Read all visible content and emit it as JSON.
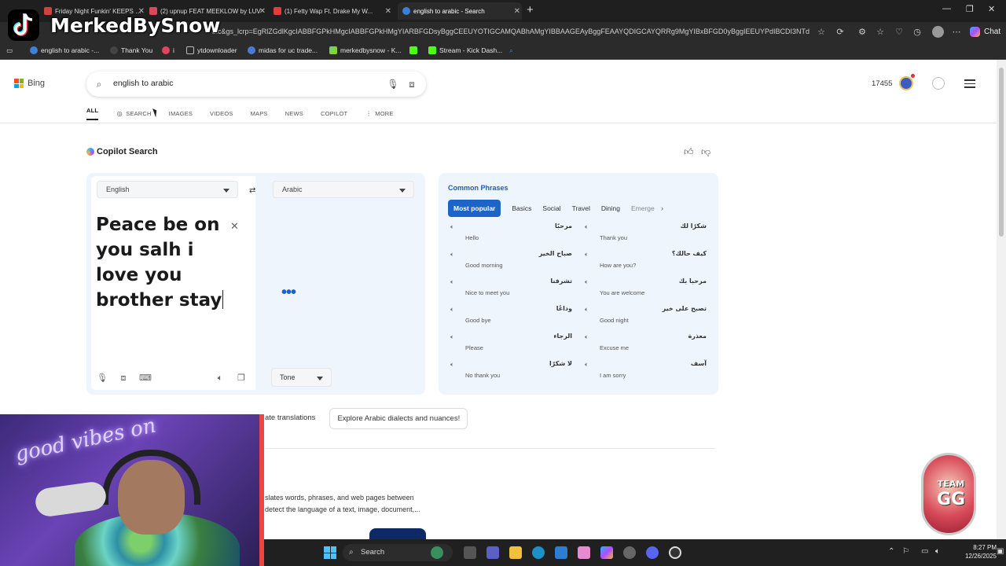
{
  "tabs": [
    {
      "label": "Friday Night Funkin' KEEPS GE...",
      "color": "#d43f3f"
    },
    {
      "label": "(2) upnup FEAT MEEKLOW by LUV",
      "color": "#e0465b"
    },
    {
      "label": "(1) Fetty Wap Ft. Drake My W...",
      "color": "#e43b3b"
    },
    {
      "label": "english to arabic - Search",
      "color": "#3b82d6"
    }
  ],
  "address": {
    "url": "bic&gs_lcrp=EgRlZGdlKgcIABBFGPkHMgcIABBFGPkHMgYIARBFGDsyBggCEEUYOTIGCAMQABhAMgYIBBAAGEAyBggFEAAYQDIGCAYQRRg9MgYIBxBFGD0yBggIEEUYPdIBCDI3NTdqMG..."
  },
  "chat_label": "Chat",
  "bookmarks": [
    {
      "label": "english to arabic -...",
      "color": "#3b82d6"
    },
    {
      "label": "Thank You",
      "color": "#444"
    },
    {
      "label": "i",
      "color": "#e0465b"
    },
    {
      "label": "ytdownloader",
      "color": "#888"
    },
    {
      "label": "midas for uc trade...",
      "color": "#4a7bd8"
    },
    {
      "label": "merkedbysnow - K...",
      "color": "#7cd34a"
    },
    {
      "label": "",
      "color": "#53fc18"
    },
    {
      "label": "Stream - Kick Dash...",
      "color": "#53fc18"
    }
  ],
  "overlay": {
    "name": "MerkedBySnow"
  },
  "bing": {
    "brand": "Bing",
    "query": "english to arabic",
    "rewards_points": "17455",
    "nav": [
      "ALL",
      "SEARCH",
      "IMAGES",
      "VIDEOS",
      "MAPS",
      "NEWS",
      "COPILOT",
      "MORE"
    ],
    "copilot_title": "Copilot Search"
  },
  "translator": {
    "source_lang": "English",
    "target_lang": "Arabic",
    "input_text": "Peace be on you salh i love you brother stay",
    "output_placeholder": "•••",
    "tone_label": "Tone"
  },
  "phrases": {
    "title": "Common Phrases",
    "tabs": [
      "Most popular",
      "Basics",
      "Social",
      "Travel",
      "Dining",
      "Emerge"
    ],
    "items": [
      {
        "ar": "مرحبًا",
        "en": "Hello"
      },
      {
        "ar": "شكرًا لك",
        "en": "Thank you"
      },
      {
        "ar": "صباح الخير",
        "en": "Good morning"
      },
      {
        "ar": "كيف حالك؟",
        "en": "How are you?"
      },
      {
        "ar": "تشرفنا",
        "en": "Nice to meet you"
      },
      {
        "ar": "مرحبا بك",
        "en": "You are welcome"
      },
      {
        "ar": "وداعًا",
        "en": "Good bye"
      },
      {
        "ar": "تصبح على خير",
        "en": "Good night"
      },
      {
        "ar": "الرجاء",
        "en": "Please"
      },
      {
        "ar": "معذرة",
        "en": "Excuse me"
      },
      {
        "ar": "لا شكرًا",
        "en": "No thank you"
      },
      {
        "ar": "آسف",
        "en": "I am sorry"
      }
    ]
  },
  "chips": [
    "ate translations",
    "Explore Arabic dialects and nuances!"
  ],
  "description": [
    "slates words, phrases, and web pages between",
    "detect the language of a text, image, document,..."
  ],
  "badge": {
    "line1": "TEAM",
    "line2": "GG"
  },
  "webcam": {
    "neon_text": "good vibes on"
  },
  "taskbar": {
    "search_label": "Search",
    "time": "8:27 PM",
    "date": "12/26/2025"
  }
}
